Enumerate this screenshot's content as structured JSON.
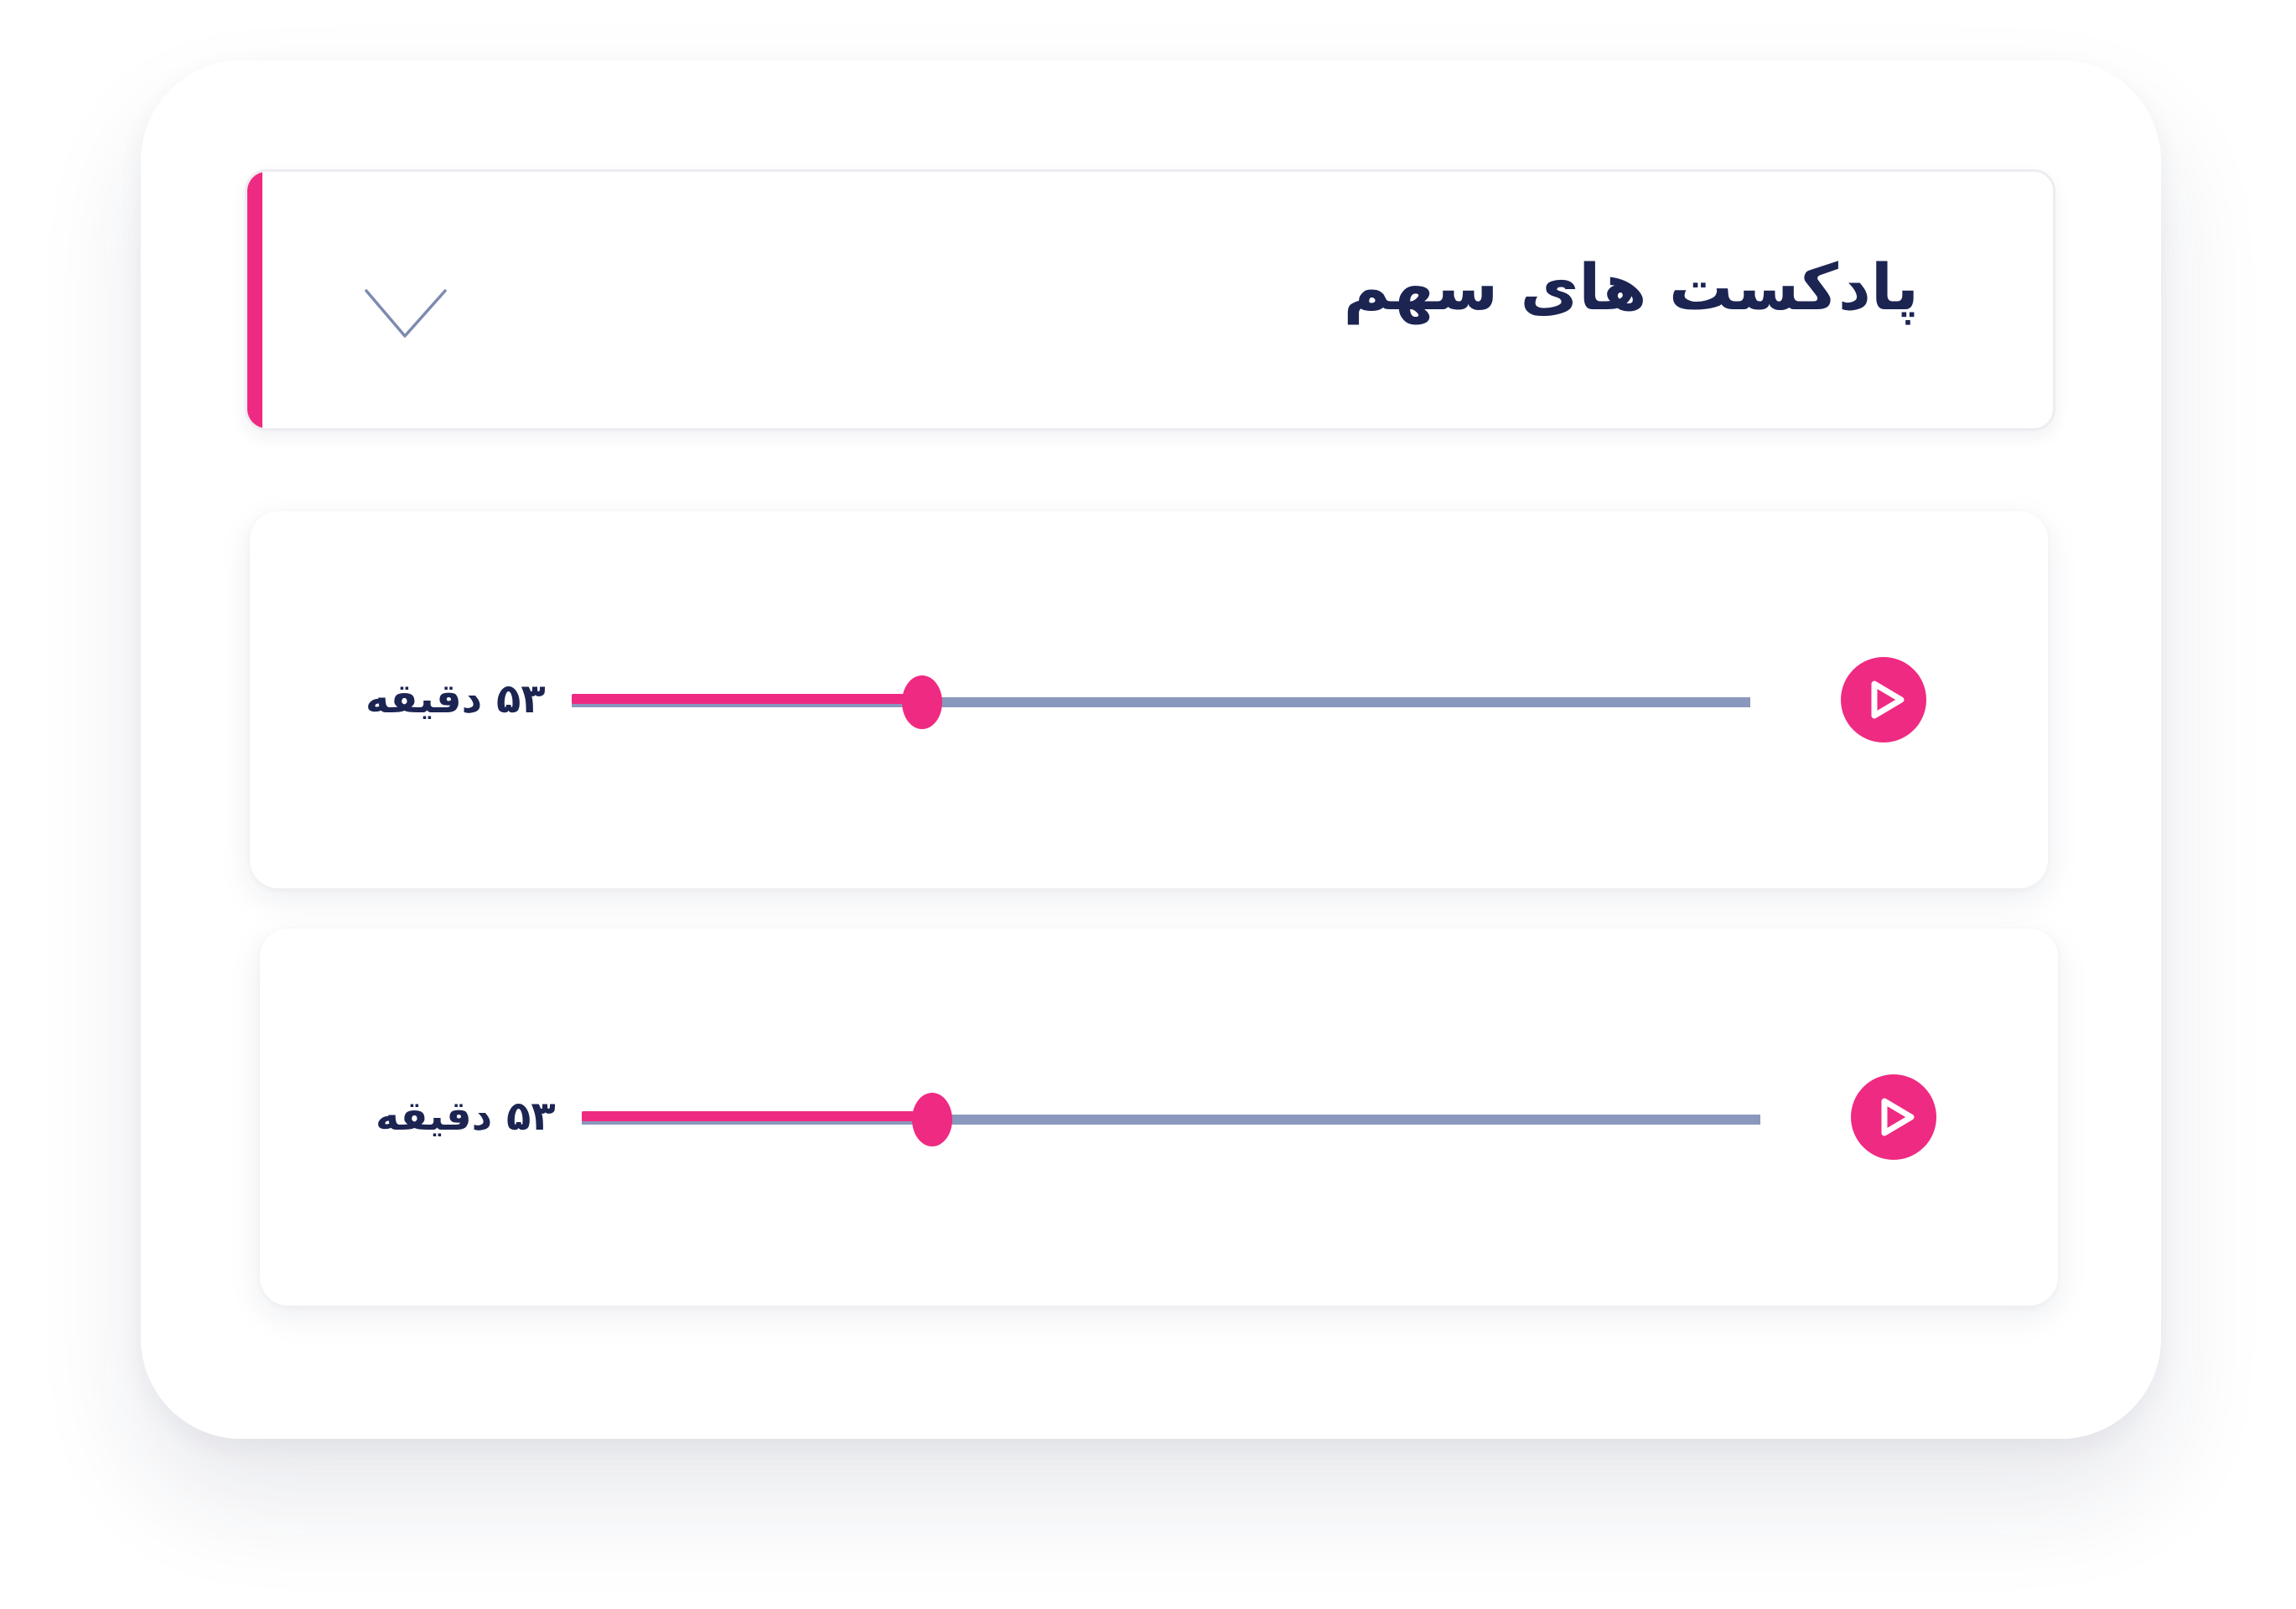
{
  "header": {
    "title": "پادکست های سهم",
    "toggle_icon": "chevron-down-icon"
  },
  "podcasts": [
    {
      "duration_label": "۵۳ دقیقه",
      "progress": 0.297,
      "play_icon": "play-icon"
    },
    {
      "duration_label": "۵۳ دقیقه",
      "progress": 0.297,
      "play_icon": "play-icon"
    }
  ],
  "colors": {
    "accent": "#ef2a82",
    "text": "#1c2452",
    "track": "#8a98bd"
  }
}
